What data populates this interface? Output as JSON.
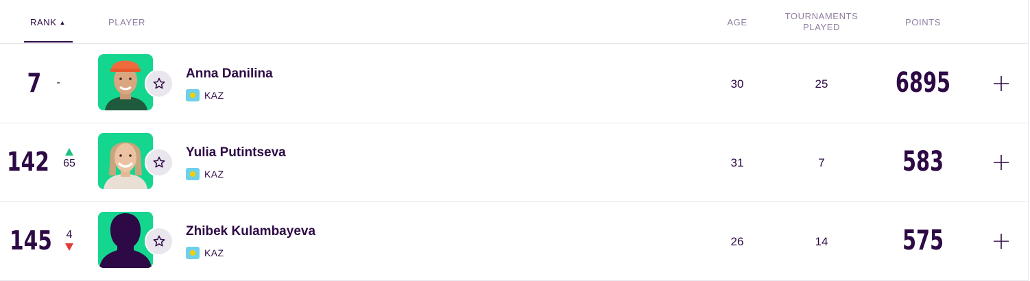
{
  "header": {
    "rank": "RANK",
    "player": "PLAYER",
    "age": "AGE",
    "tournaments_played_line1": "TOURNAMENTS",
    "tournaments_played_line2": "PLAYED",
    "points": "POINTS",
    "sort_icon": "sort-up-icon"
  },
  "colors": {
    "text": "#2d0a45",
    "photo_bg": "#15d68f",
    "movement_up": "#19c37d",
    "movement_down": "#e53935"
  },
  "rows": [
    {
      "rank": "7",
      "movement_text": "-",
      "movement_dir": "none",
      "name": "Anna Danilina",
      "country": "KAZ",
      "age": "30",
      "tournaments_played": "25",
      "points": "6895"
    },
    {
      "rank": "142",
      "movement_text": "65",
      "movement_dir": "up",
      "name": "Yulia Putintseva",
      "country": "KAZ",
      "age": "31",
      "tournaments_played": "7",
      "points": "583"
    },
    {
      "rank": "145",
      "movement_text": "4",
      "movement_dir": "down",
      "name": "Zhibek Kulambayeva",
      "country": "KAZ",
      "age": "26",
      "tournaments_played": "14",
      "points": "575"
    }
  ]
}
